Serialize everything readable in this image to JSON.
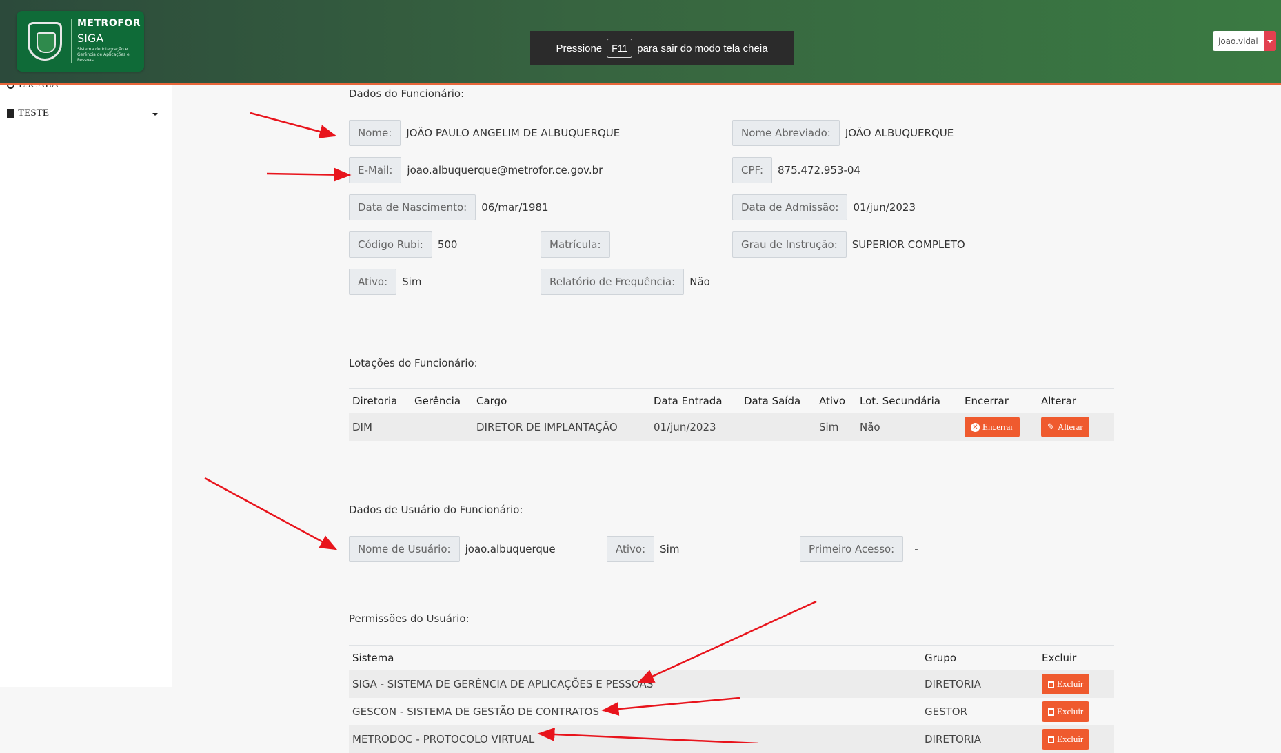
{
  "header": {
    "logo_title": "METROFOR",
    "logo_subtitle": "SIGA",
    "logo_description": "Sistema de Integração e Gerência de Aplicações e Pessoas",
    "fullscreen_pre": "Pressione",
    "fullscreen_key": "F11",
    "fullscreen_post": "para sair do modo tela cheia",
    "user": "joao.vidal"
  },
  "sidebar": {
    "items": [
      {
        "label": "ESCALA",
        "icon": "clock-icon"
      },
      {
        "label": "TESTE",
        "icon": "file-icon"
      }
    ]
  },
  "employee": {
    "title": "Dados do Funcionário:",
    "nome_label": "Nome:",
    "nome": "JOÃO PAULO ANGELIM DE ALBUQUERQUE",
    "nome_abrev_label": "Nome Abreviado:",
    "nome_abrev": "JOÃO ALBUQUERQUE",
    "email_label": "E-Mail:",
    "email": "joao.albuquerque@metrofor.ce.gov.br",
    "cpf_label": "CPF:",
    "cpf": "875.472.953-04",
    "nascimento_label": "Data de Nascimento:",
    "nascimento": "06/mar/1981",
    "admissao_label": "Data de Admissão:",
    "admissao": "01/jun/2023",
    "rubi_label": "Código Rubi:",
    "rubi": "500",
    "matricula_label": "Matrícula:",
    "matricula": "",
    "instrucao_label": "Grau de Instrução:",
    "instrucao": "SUPERIOR COMPLETO",
    "ativo_label": "Ativo:",
    "ativo": "Sim",
    "freq_label": "Relatório de Frequência:",
    "freq": "Não"
  },
  "lotacoes": {
    "title": "Lotações do Funcionário:",
    "headers": [
      "Diretoria",
      "Gerência",
      "Cargo",
      "Data Entrada",
      "Data Saída",
      "Ativo",
      "Lot. Secundária",
      "Encerrar",
      "Alterar"
    ],
    "rows": [
      {
        "diretoria": "DIM",
        "gerencia": "",
        "cargo": "DIRETOR DE IMPLANTAÇÃO",
        "entrada": "01/jun/2023",
        "saida": "",
        "ativo": "Sim",
        "secundaria": "Não",
        "encerrar": "Encerrar",
        "alterar": "Alterar"
      }
    ]
  },
  "user_data": {
    "title": "Dados de Usuário do Funcionário:",
    "username_label": "Nome de Usuário:",
    "username": "joao.albuquerque",
    "ativo_label": "Ativo:",
    "ativo": "Sim",
    "primeiro_label": "Primeiro Acesso:",
    "primeiro": "-"
  },
  "permissions": {
    "title": "Permissões do Usuário:",
    "headers": [
      "Sistema",
      "Grupo",
      "Excluir"
    ],
    "rows": [
      {
        "sistema": "SIGA - SISTEMA DE GERÊNCIA DE APLICAÇÕES E PESSOAS",
        "grupo": "DIRETORIA",
        "excluir": "Excluir"
      },
      {
        "sistema": "GESCON - SISTEMA DE GESTÃO DE CONTRATOS",
        "grupo": "GESTOR",
        "excluir": "Excluir"
      },
      {
        "sistema": "METRODOC - PROTOCOLO VIRTUAL",
        "grupo": "DIRETORIA",
        "excluir": "Excluir"
      }
    ]
  },
  "colors": {
    "accent": "#ef5a2e",
    "header_green": "#3a7a42",
    "annotation_red": "#e8141c"
  }
}
